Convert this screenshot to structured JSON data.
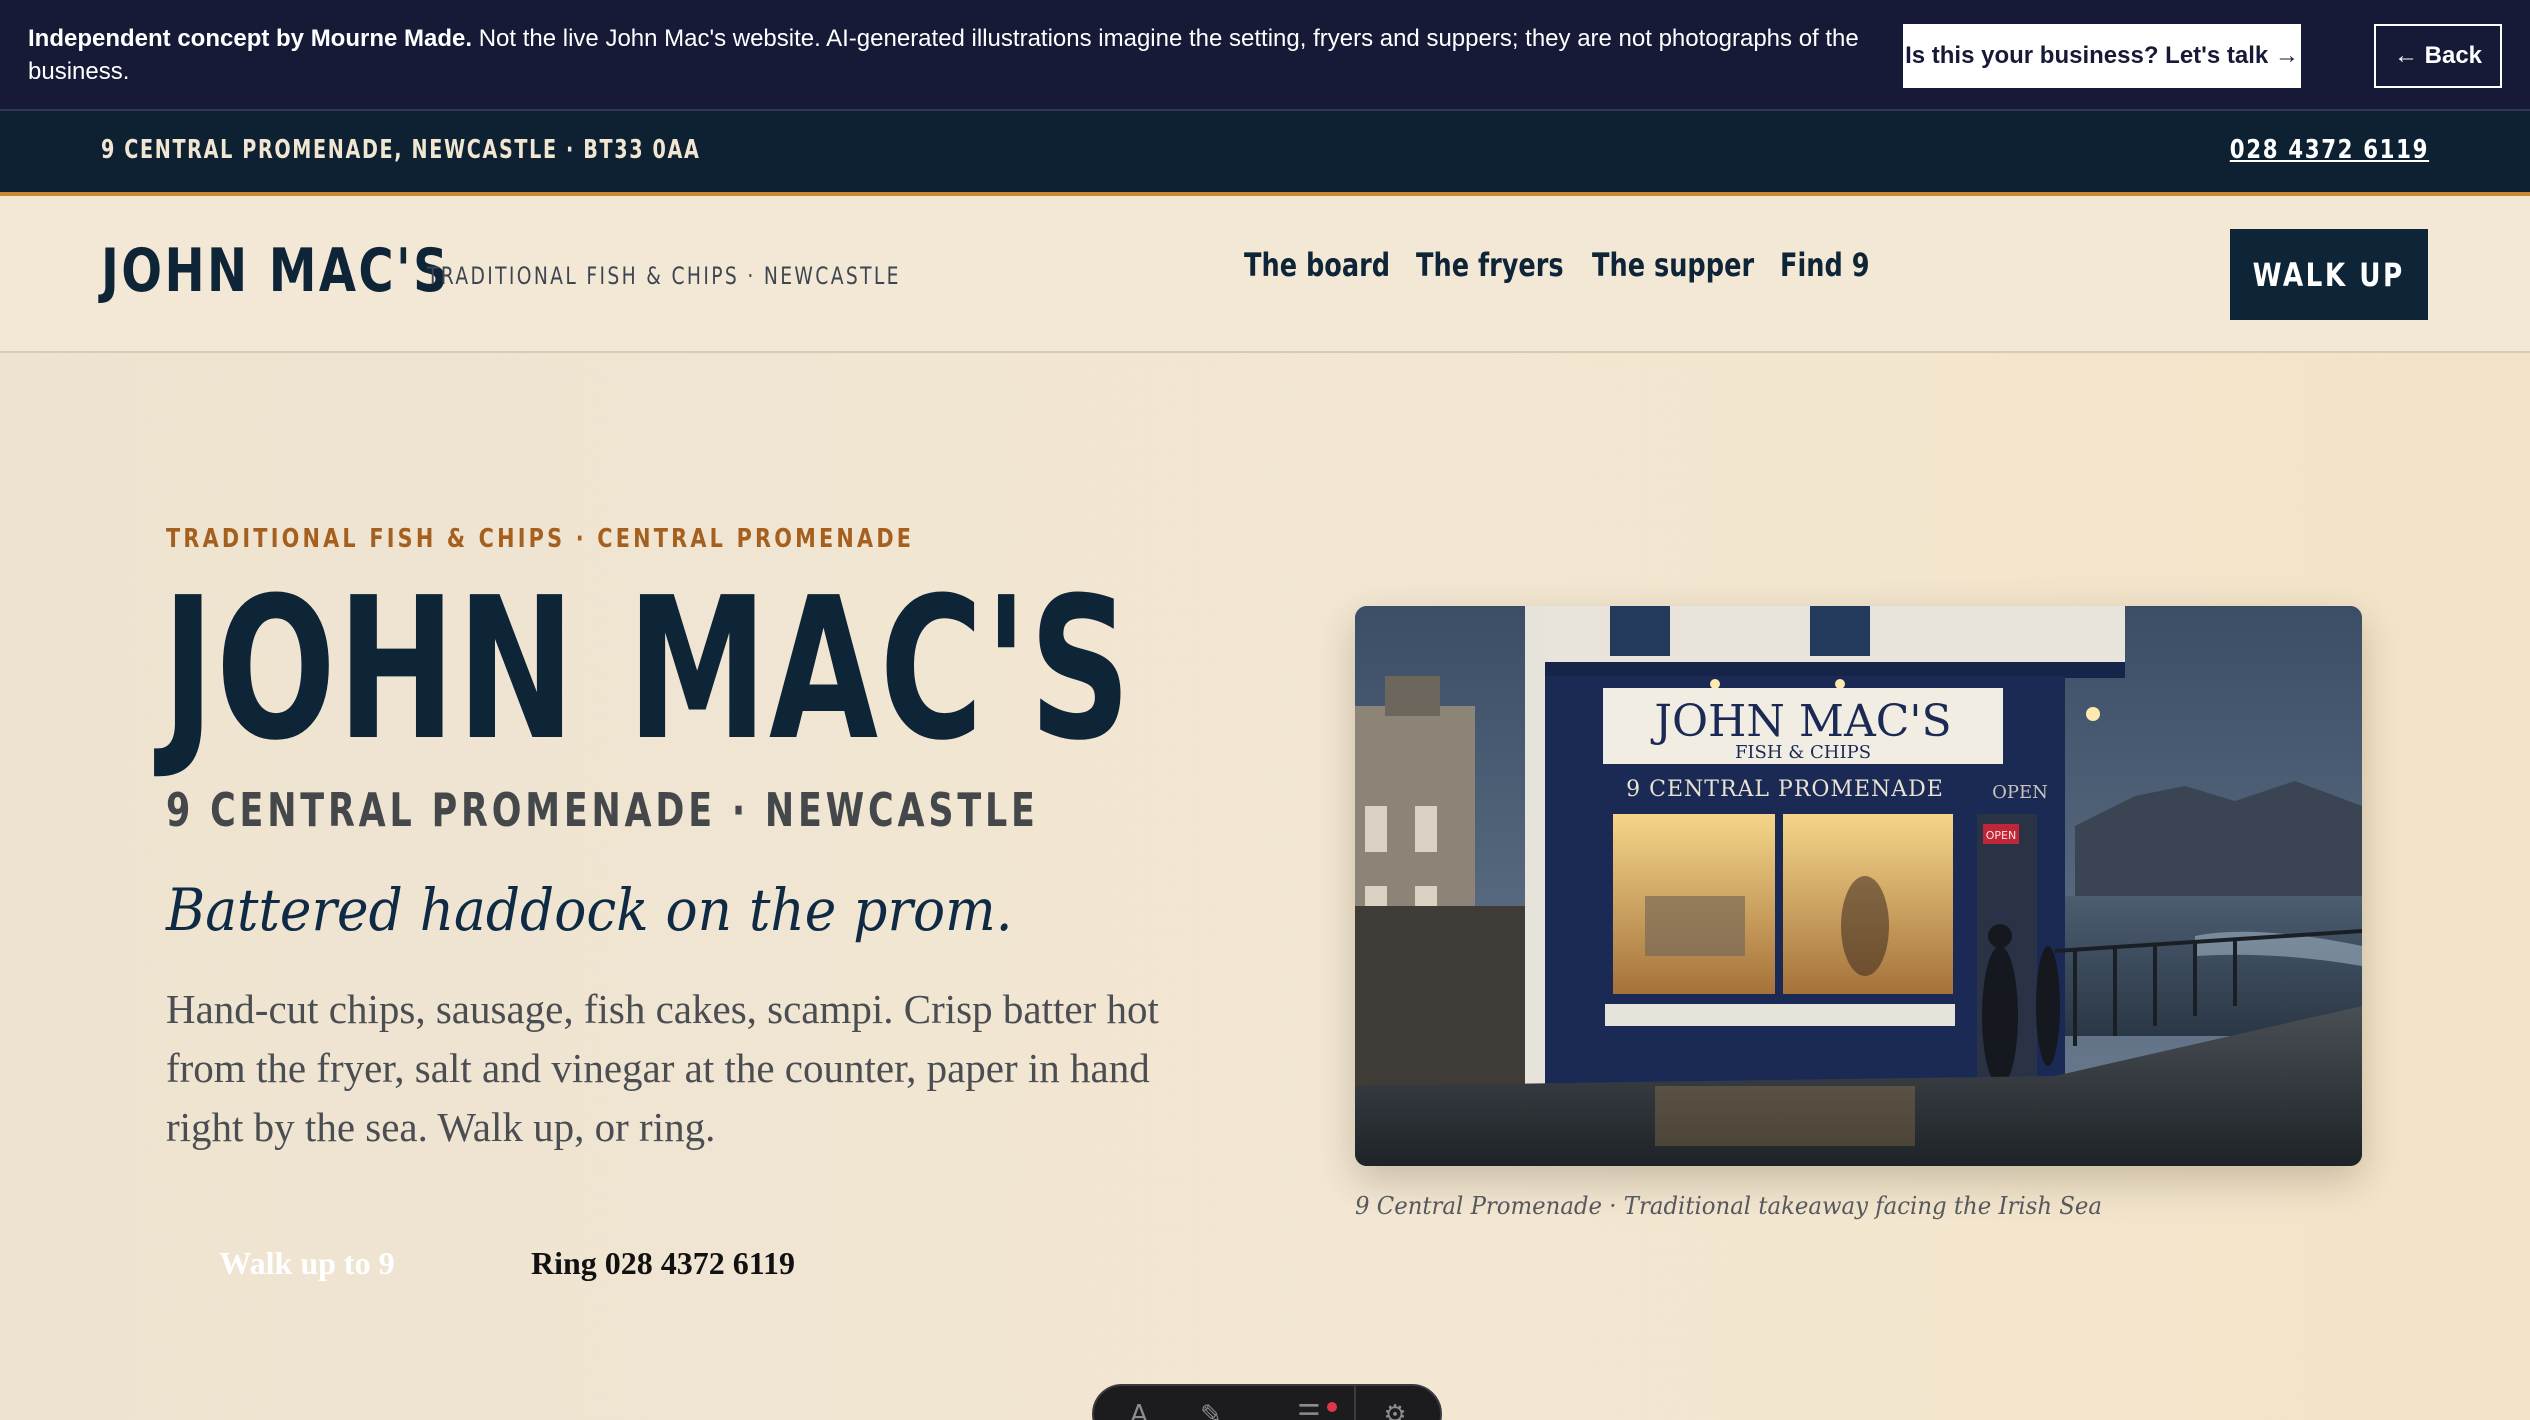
{
  "banner": {
    "lead": "Independent concept by Mourne Made.",
    "text": " Not the live John Mac's website. AI-generated illustrations imagine the setting, fryers and suppers; they are not photographs of the business.",
    "talk_label": "Is this your business? Let's talk →",
    "back_label": "← Back"
  },
  "topbar": {
    "address": "9 CENTRAL PROMENADE, NEWCASTLE · BT33 0AA",
    "phone": "028 4372 6119"
  },
  "nav": {
    "brand": "JOHN MAC'S",
    "tagline": "TRADITIONAL FISH & CHIPS · NEWCASTLE",
    "links": [
      "The board",
      "The fryers",
      "The supper",
      "Find 9"
    ],
    "cta": "WALK UP"
  },
  "hero": {
    "eyebrow": "TRADITIONAL FISH & CHIPS · CENTRAL PROMENADE",
    "title": "JOHN MAC'S",
    "address": "9 CENTRAL PROMENADE · NEWCASTLE",
    "tagline": "Battered haddock on the prom.",
    "body": "Hand-cut chips, sausage, fish cakes, scampi. Crisp batter hot from the fryer, salt and vinegar at the counter, paper in hand right by the sea. Walk up, or ring.",
    "cta_walk": "Walk up to 9",
    "cta_ring": "Ring 028 4372 6119"
  },
  "photo": {
    "sign_name": "JOHN MAC'S",
    "sign_sub": "FISH & CHIPS",
    "fascia": "9 CENTRAL PROMENADE",
    "open_text": "OPEN",
    "open_sign": "OPEN",
    "caption": "9 Central Promenade · Traditional takeaway facing the Irish Sea"
  },
  "toolbar": {
    "icons": [
      "text-icon",
      "brush-icon",
      "menu-icon",
      "settings-icon"
    ]
  },
  "colors": {
    "navy": "#0e2437",
    "banner": "#161a36",
    "accent": "#c98b35",
    "eyebrow": "#a5601f",
    "cream": "#f3e8d6"
  }
}
